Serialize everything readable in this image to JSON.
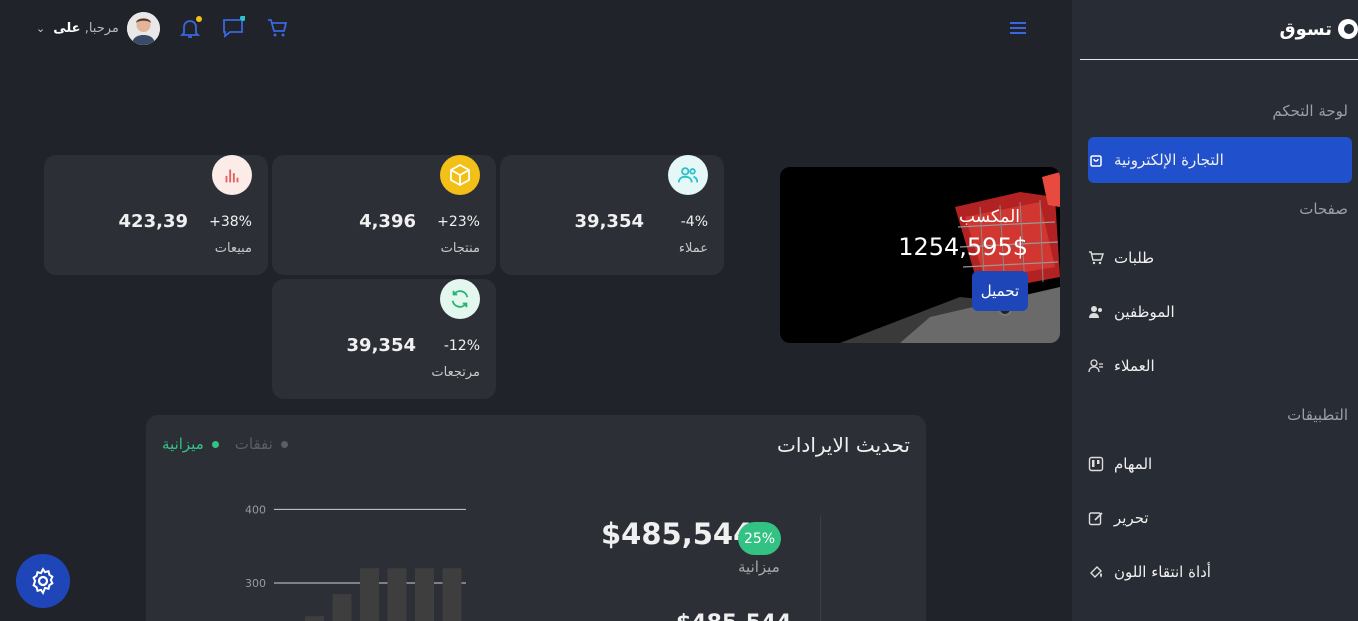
{
  "brand": {
    "name": "تسوق"
  },
  "sidebar": {
    "sections": [
      {
        "label": "لوحة التحكم"
      },
      {
        "label": "صفحات"
      },
      {
        "label": "التطبيقات"
      }
    ],
    "items": [
      {
        "label": "التجارة الإلكترونية",
        "icon": "shopping-bag-icon",
        "active": true
      },
      {
        "label": "طلبات",
        "icon": "cart-icon"
      },
      {
        "label": "الموظفين",
        "icon": "staff-icon"
      },
      {
        "label": "العملاء",
        "icon": "customers-icon"
      },
      {
        "label": "المهام",
        "icon": "kanban-icon"
      },
      {
        "label": "تحرير",
        "icon": "edit-icon"
      },
      {
        "label": "أداة انتقاء اللون",
        "icon": "color-picker-icon"
      }
    ]
  },
  "topbar": {
    "greeting": "مرحبا,",
    "user_name": "على"
  },
  "promo": {
    "title": "المكسب",
    "value": "1254,595$",
    "button": "تحميل"
  },
  "stats": [
    {
      "label": "عملاء",
      "value": "39,354",
      "pct": "-4%",
      "icon": "users-icon",
      "color": "#28c2c8"
    },
    {
      "label": "منتجات",
      "value": "4,396",
      "pct": "+23%",
      "icon": "box-icon",
      "color": "#f2c016"
    },
    {
      "label": "مبيعات",
      "value": "423,39",
      "pct": "+38%",
      "icon": "bar-chart-icon",
      "color": "#e0605a"
    },
    {
      "label": "مرتجعات",
      "value": "39,354",
      "pct": "-12%",
      "icon": "refresh-icon",
      "color": "#24b574"
    }
  ],
  "revenue": {
    "title": "تحديث الايرادات",
    "legend": [
      {
        "label": "ميزانية",
        "color": "#33c283"
      },
      {
        "label": "نفقات",
        "color": "#5a5e66"
      }
    ],
    "amount": "$485,544",
    "badge": "25%",
    "sub": "ميزانية",
    "amount2": "$485,544"
  },
  "chart_data": {
    "type": "bar",
    "categories": [
      "",
      "",
      "",
      "",
      "",
      "",
      ""
    ],
    "series": [
      {
        "values": [
          255,
          285,
          320,
          320,
          320,
          320
        ]
      }
    ],
    "yticks": [
      300,
      400
    ],
    "ylim": [
      220,
      410
    ]
  }
}
